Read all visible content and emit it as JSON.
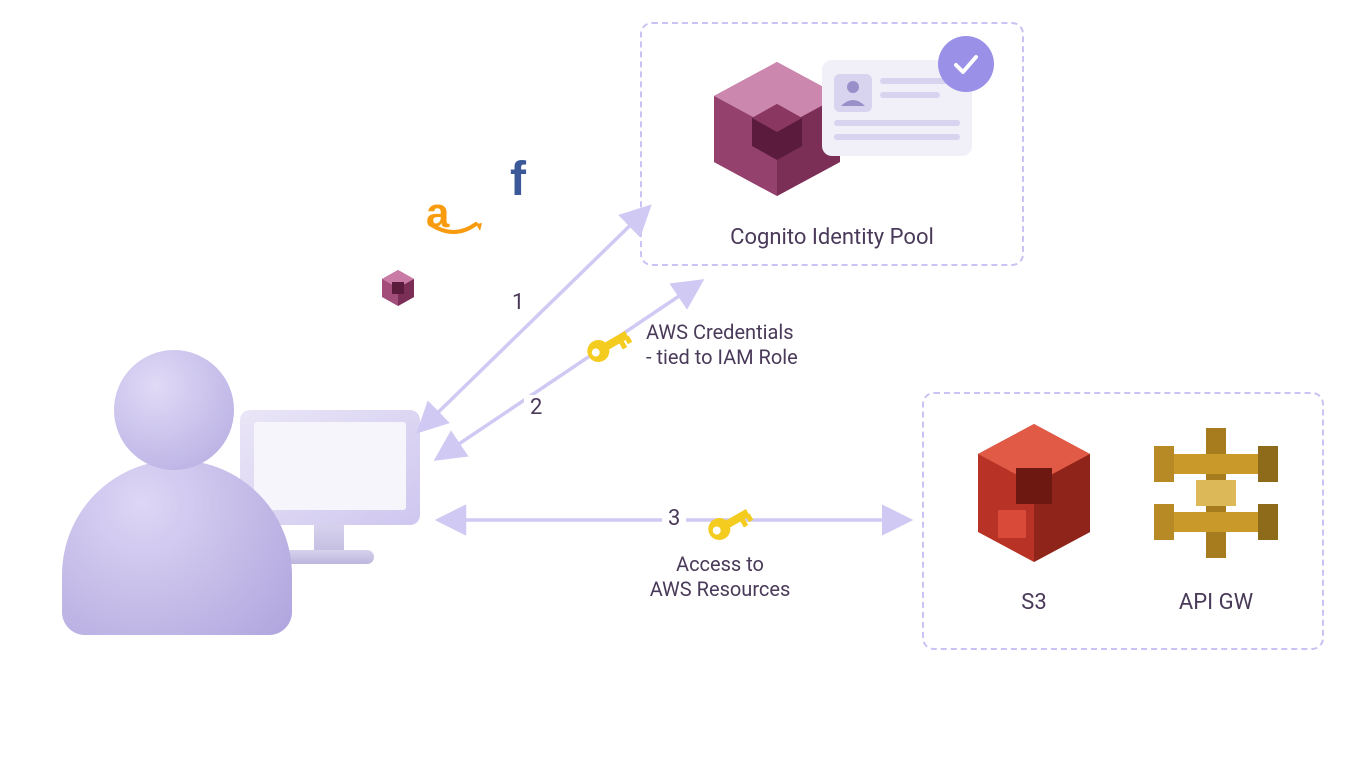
{
  "diagram": {
    "nodes": {
      "user": {
        "name": "user-with-computer"
      },
      "idp_icons": [
        "cognito-small",
        "amazon",
        "facebook"
      ],
      "cognito_box": {
        "label": "Cognito Identity Pool"
      },
      "resources_box": {
        "s3_label": "S3",
        "apigw_label": "API GW"
      }
    },
    "arrows": {
      "step1": {
        "num": "1"
      },
      "step2": {
        "num": "2",
        "label_line1": "AWS Credentials",
        "label_line2": "- tied to IAM Role"
      },
      "step3": {
        "num": "3",
        "label_line1": "Access to",
        "label_line2": "AWS Resources"
      }
    }
  }
}
